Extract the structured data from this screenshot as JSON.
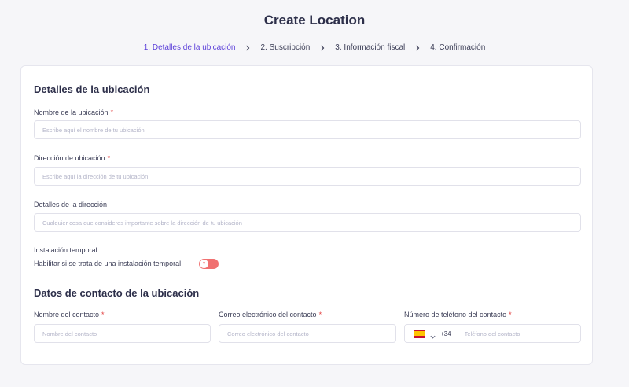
{
  "header": {
    "title": "Create Location"
  },
  "stepper": {
    "steps": [
      {
        "label": "1. Detalles de la ubicación",
        "active": true
      },
      {
        "label": "2. Suscripción",
        "active": false
      },
      {
        "label": "3. Información fiscal",
        "active": false
      },
      {
        "label": "4. Confirmación",
        "active": false
      }
    ]
  },
  "location_details": {
    "section_title": "Detalles de la ubicación",
    "name": {
      "label": "Nombre de la ubicación",
      "required_mark": "*",
      "placeholder": "Escribe aquí el nombre de tu ubicación",
      "value": ""
    },
    "address": {
      "label": "Dirección de ubicación",
      "required_mark": "*",
      "placeholder": "Escribe aquí la dirección de tu ubicación",
      "value": ""
    },
    "address_details": {
      "label": "Detalles de la dirección",
      "placeholder": "Cualquier cosa que consideres importante sobre la dirección de tu ubicación",
      "value": ""
    },
    "temporary": {
      "label": "Instalación temporal",
      "toggle_label": "Habilitar si se trata de una instalación temporal",
      "enabled": false,
      "knob_glyph": "×"
    }
  },
  "contact": {
    "section_title": "Datos de contacto de la ubicación",
    "name": {
      "label": "Nombre del contacto",
      "required_mark": "*",
      "placeholder": "Nombre del contacto"
    },
    "email": {
      "label": "Correo electrónico del contacto",
      "required_mark": "*",
      "placeholder": "Correo electrónico del contacto"
    },
    "phone": {
      "label": "Número de teléfono del contacto",
      "required_mark": "*",
      "country_flag": "es-flag-icon",
      "dial_code": "+34",
      "placeholder": "Teléfono del contacto"
    }
  },
  "colors": {
    "accent": "#5b3fd9",
    "required": "#e23b3b",
    "toggle_off": "#f07070"
  }
}
